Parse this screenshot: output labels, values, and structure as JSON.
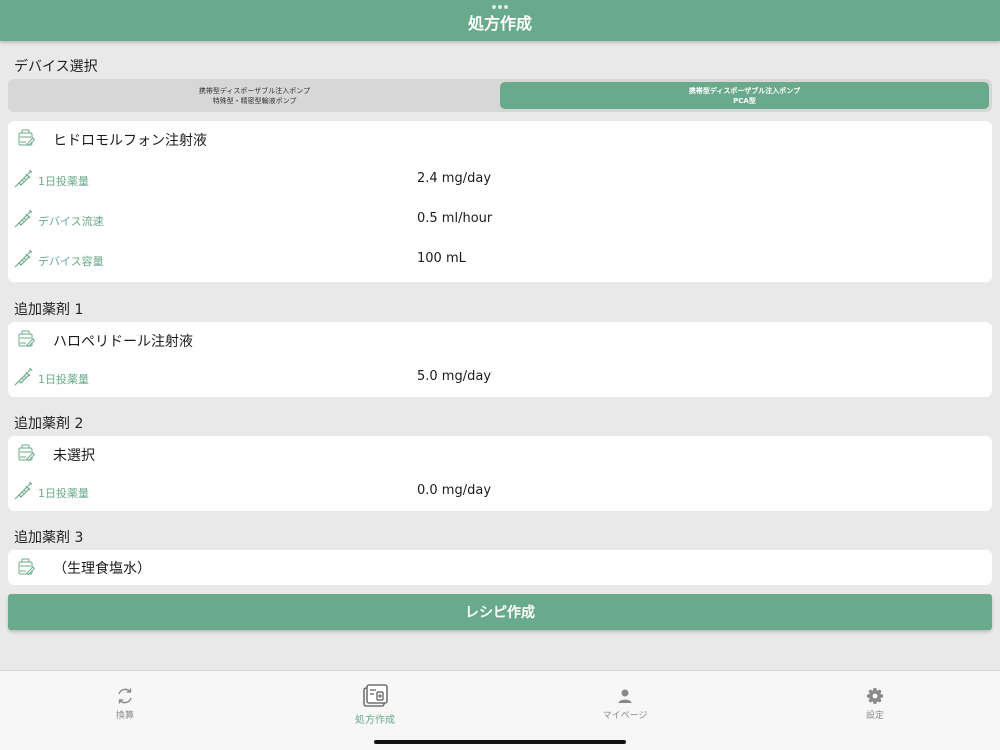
{
  "header": {
    "title": "処方作成"
  },
  "device_section": {
    "label": "デバイス選択",
    "options": [
      {
        "line1": "携帯型ディスポーザブル注入ポンプ",
        "line2": "特殊型・精密型輸液ポンプ",
        "selected": false
      },
      {
        "line1": "携帯型ディスポーザブル注入ポンプ",
        "line2": "PCA型",
        "selected": true
      }
    ]
  },
  "main_drug": {
    "name": "ヒドロモルフォン注射液",
    "params": [
      {
        "label": "1日投薬量",
        "value": "2.4 mg/day"
      },
      {
        "label": "デバイス流速",
        "value": "0.5 ml/hour"
      },
      {
        "label": "デバイス容量",
        "value": "100 mL"
      }
    ]
  },
  "additional_1": {
    "label": "追加薬剤 1",
    "name": "ハロペリドール注射液",
    "param": {
      "label": "1日投薬量",
      "value": "5.0 mg/day"
    }
  },
  "additional_2": {
    "label": "追加薬剤 2",
    "name": "未選択",
    "param": {
      "label": "1日投薬量",
      "value": "0.0 mg/day"
    }
  },
  "additional_3": {
    "label": "追加薬剤 3",
    "name": "（生理食塩水）"
  },
  "recipe_button": {
    "label": "レシピ作成"
  },
  "tabbar": {
    "tabs": [
      {
        "label": "換算",
        "icon": "convert-icon",
        "active": false
      },
      {
        "label": "処方作成",
        "icon": "prescription-icon",
        "active": true
      },
      {
        "label": "マイページ",
        "icon": "person-icon",
        "active": false
      },
      {
        "label": "設定",
        "icon": "gear-icon",
        "active": false
      }
    ]
  },
  "colors": {
    "accent": "#6aaa8c",
    "background": "#e9e9e9",
    "card": "#ffffff"
  }
}
